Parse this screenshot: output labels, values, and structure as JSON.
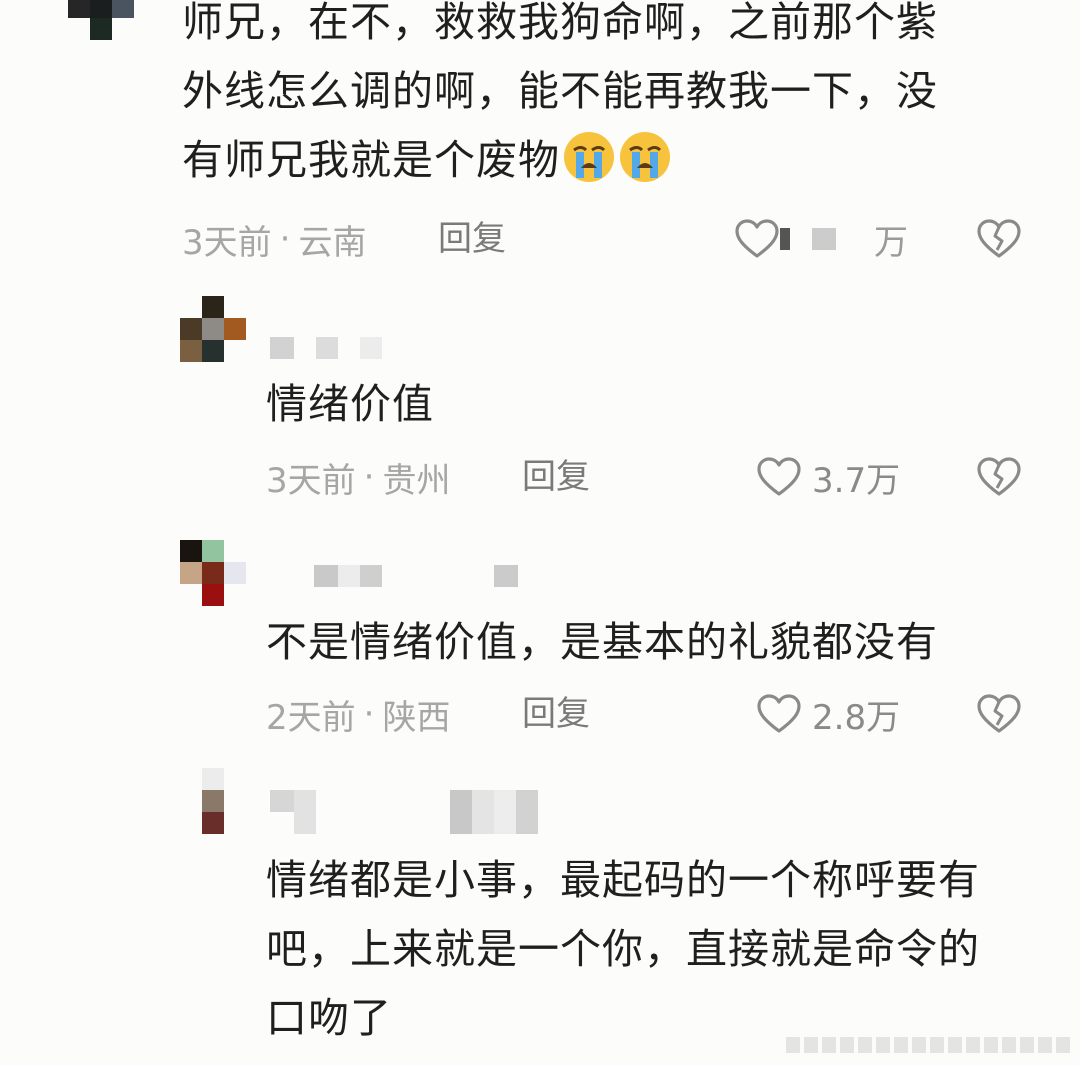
{
  "comments": [
    {
      "text_lines": [
        "师兄，在不，救救我狗命啊，之前那个紫",
        "外线怎么调的啊，能不能再教我一下，没",
        "有师兄我就是个废物"
      ],
      "emoji": [
        "loudly-crying-face",
        "loudly-crying-face"
      ],
      "time": "3天前",
      "location": "云南",
      "reply_label": "回复",
      "likes": "万"
    },
    {
      "text_lines": [
        "情绪价值"
      ],
      "time": "3天前",
      "location": "贵州",
      "reply_label": "回复",
      "likes": "3.7万"
    },
    {
      "text_lines": [
        "不是情绪价值，是基本的礼貌都没有"
      ],
      "time": "2天前",
      "location": "陕西",
      "reply_label": "回复",
      "likes": "2.8万"
    },
    {
      "text_lines": [
        "情绪都是小事，最起码的一个称呼要有",
        "吧，上来就是一个你，直接就是命令的",
        "口吻了"
      ]
    }
  ],
  "separator": "·",
  "icons": {
    "like": "heart-outline-icon",
    "dislike": "broken-heart-icon"
  },
  "colors": {
    "text": "#1f1f1f",
    "meta": "#a6a6a6",
    "icon": "#8a8a8a",
    "background": "#fcfcfa"
  }
}
